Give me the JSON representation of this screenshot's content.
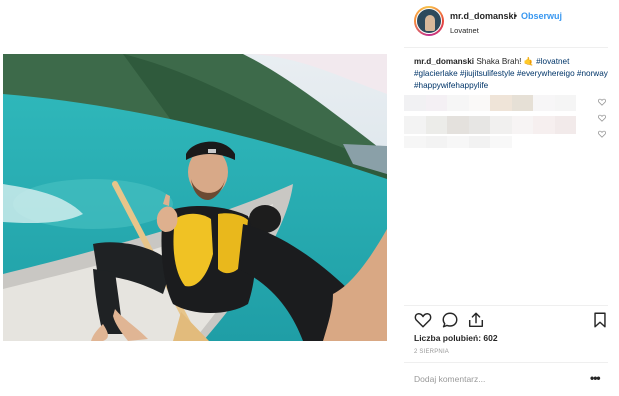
{
  "post": {
    "username": "mr.d_domanski",
    "separator": "•",
    "follow_label": "Obserwuj",
    "location": "Lovatnet",
    "caption_user": "mr.d_domanski",
    "caption_text": "Shaka Brah! 🤙",
    "caption_tags": "#lovatnet #glacierlake #jiujitsulifestyle #everywhereigo #norway #happywifehappylife",
    "likes_text": "Liczba polubień: 602",
    "date_text": "2 SIERPNIA",
    "comment_placeholder": "Dodaj komentarz...",
    "more_label": "•••"
  },
  "icons": {
    "like": "heart-icon",
    "comment": "comment-icon",
    "share": "share-icon",
    "save": "bookmark-icon"
  },
  "colors": {
    "follow": "#3897f0",
    "hashtag": "#003569",
    "lake": "#3ab5b8"
  }
}
